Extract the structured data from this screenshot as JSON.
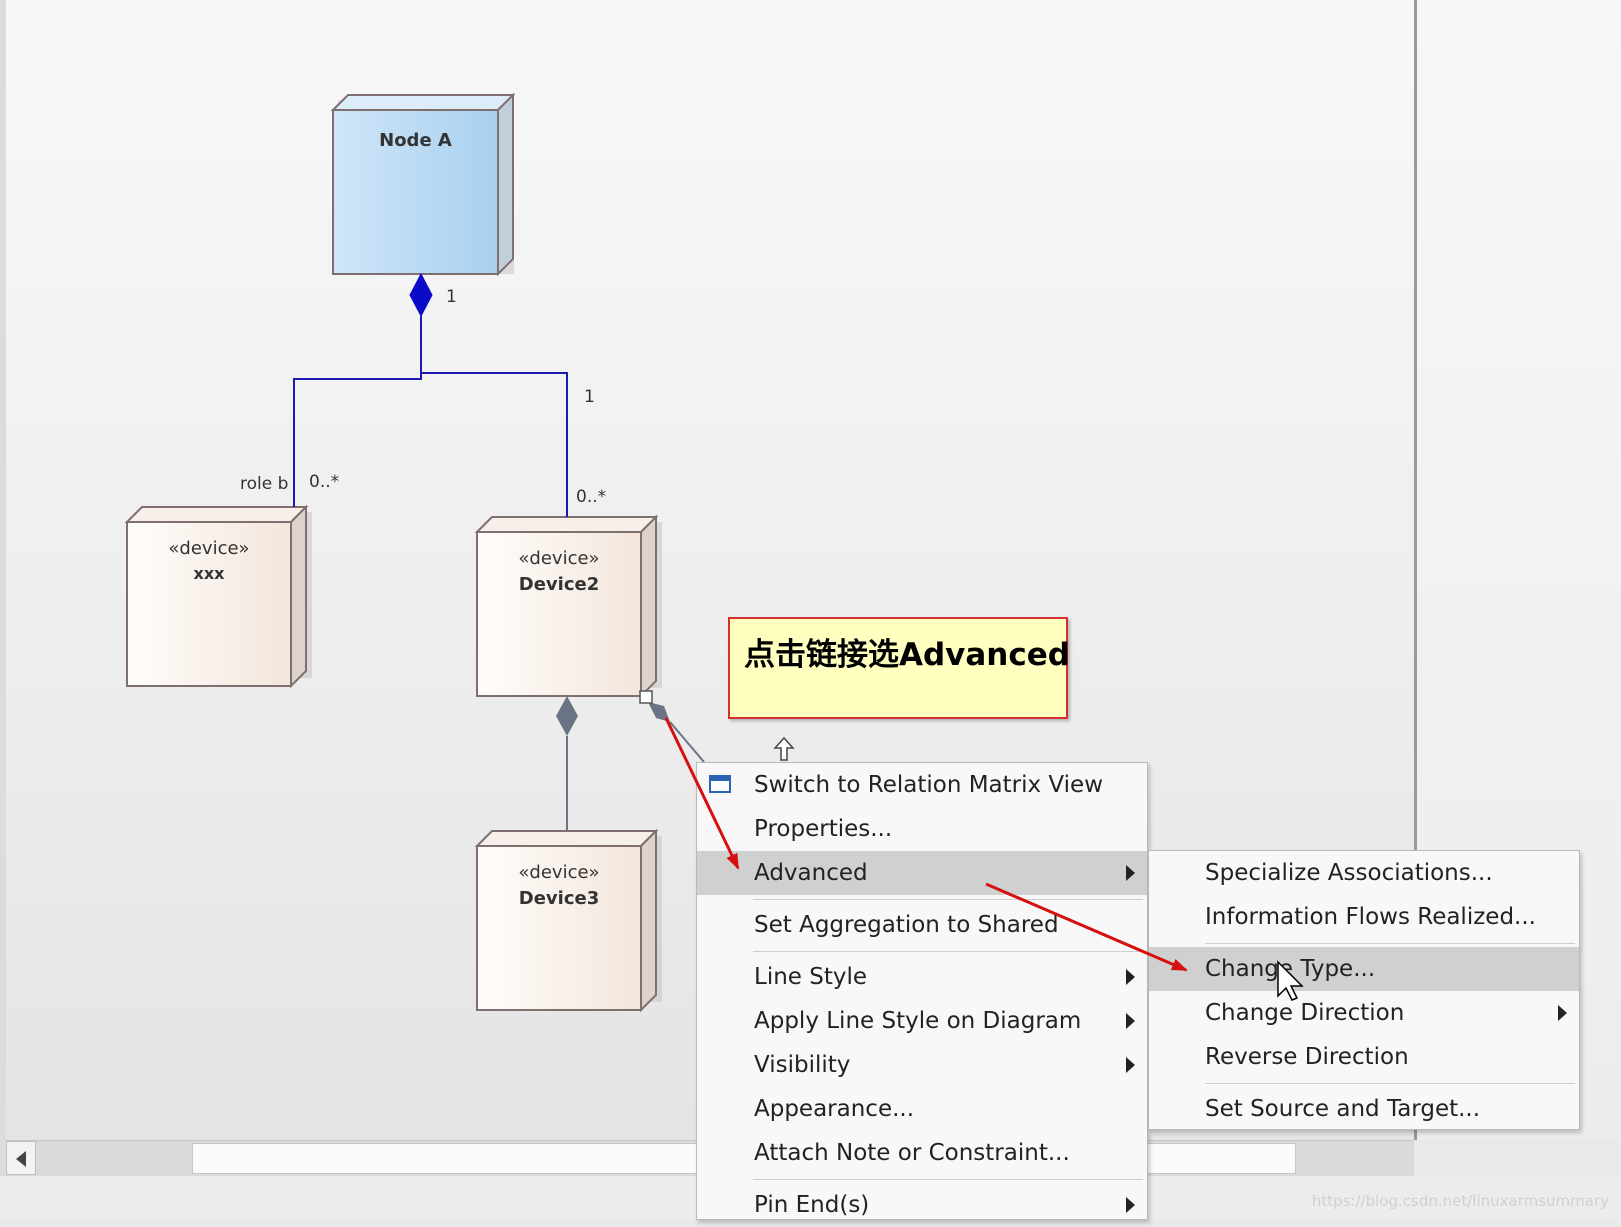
{
  "nodes": {
    "node_a": {
      "name": "Node A"
    },
    "xxx": {
      "stereotype": "«device»",
      "name": "xxx"
    },
    "device2": {
      "stereotype": "«device»",
      "name": "Device2"
    },
    "device3": {
      "stereotype": "«device»",
      "name": "Device3"
    }
  },
  "multiplicities": {
    "node_a_end": "1",
    "device2_top_1": "1",
    "role_b": "role b",
    "xxx_end": "0..*",
    "device2_end": "0..*"
  },
  "note": {
    "text": "点击链接选Advanced"
  },
  "context_menu": {
    "items": [
      {
        "label": "Switch to Relation Matrix View"
      },
      {
        "label": "Properties..."
      },
      {
        "label": "Advanced"
      },
      {
        "label": "Set Aggregation to Shared"
      },
      {
        "label": "Line Style"
      },
      {
        "label": "Apply Line Style on Diagram"
      },
      {
        "label": "Visibility"
      },
      {
        "label": "Appearance..."
      },
      {
        "label": "Attach Note or Constraint..."
      },
      {
        "label": "Pin End(s)"
      }
    ]
  },
  "submenu": {
    "items": [
      {
        "label": "Specialize Associations..."
      },
      {
        "label": "Information Flows Realized..."
      },
      {
        "label": "Change Type..."
      },
      {
        "label": "Change Direction"
      },
      {
        "label": "Reverse Direction"
      },
      {
        "label": "Set Source and Target..."
      }
    ]
  },
  "watermark": "https://blog.csdn.net/linuxarmsummary",
  "colors": {
    "association": "#1a1ab0",
    "highlight": "#d0d0d0",
    "note_border": "#d43030",
    "annotation_arrow": "#d41010"
  }
}
